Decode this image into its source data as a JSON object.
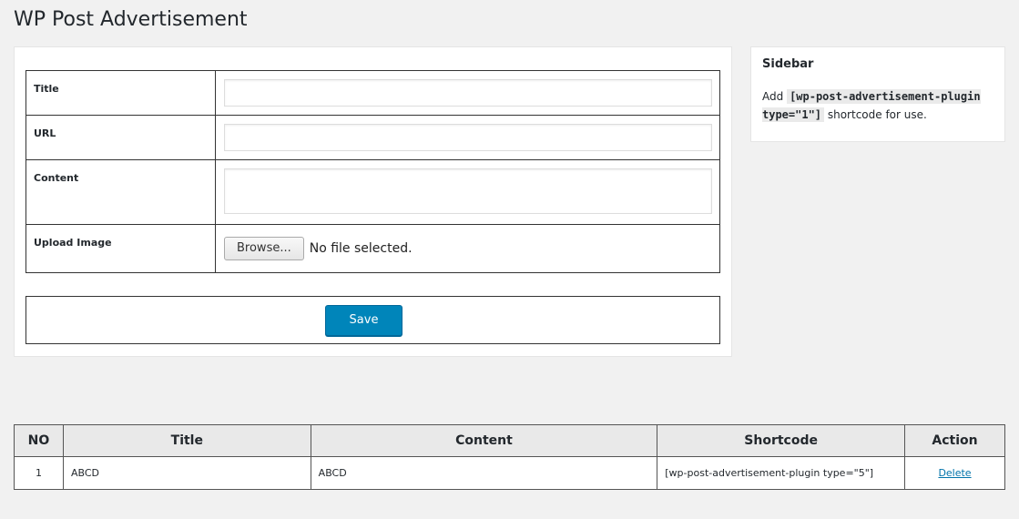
{
  "page": {
    "title": "WP Post Advertisement"
  },
  "form": {
    "title_label": "Title",
    "title_value": "",
    "url_label": "URL",
    "url_value": "",
    "content_label": "Content",
    "content_value": "",
    "upload_label": "Upload Image",
    "browse_label": "Browse...",
    "no_file_text": "No file selected.",
    "save_label": "Save"
  },
  "sidebar": {
    "title": "Sidebar",
    "text_prefix": "Add",
    "shortcode": "[wp-post-advertisement-plugin type=\"1\"]",
    "text_suffix": "shortcode for use."
  },
  "table": {
    "headers": [
      "NO",
      "Title",
      "Content",
      "Shortcode",
      "Action"
    ],
    "rows": [
      {
        "no": "1",
        "title": "ABCD",
        "content": "ABCD",
        "shortcode": "[wp-post-advertisement-plugin type=\"5\"]",
        "action": "Delete"
      }
    ]
  },
  "colors": {
    "primary_button": "#0085ba",
    "link": "#0073aa",
    "background": "#f1f1f1"
  }
}
